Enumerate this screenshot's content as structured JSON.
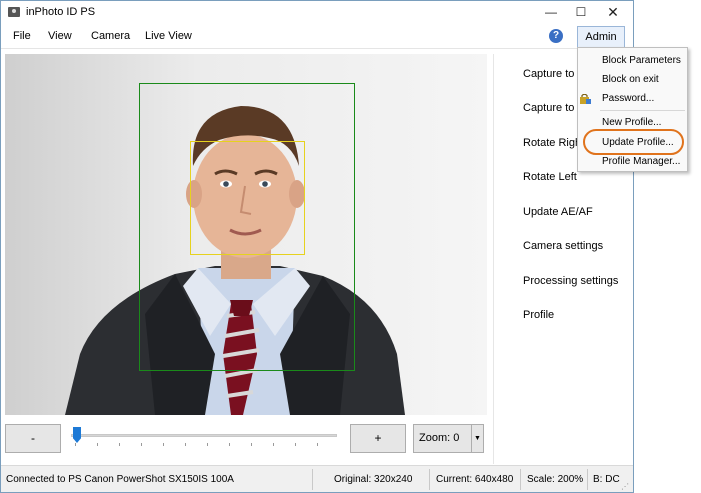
{
  "window": {
    "title": "inPhoto ID PS",
    "controls": {
      "minimize": "—",
      "maximize": "☐",
      "close": "✕"
    }
  },
  "menu": {
    "items": [
      "File",
      "View",
      "Camera",
      "Live View"
    ],
    "help_glyph": "?",
    "admin_label": "Admin"
  },
  "admin_menu": {
    "items": [
      "Block Parameters",
      "Block on exit",
      "Password...",
      "New Profile...",
      "Update Profile...",
      "Profile Manager..."
    ],
    "highlighted": "Update Profile..."
  },
  "side_panel": {
    "items": [
      "Capture to T",
      "Capture to F",
      "Rotate Right",
      "Rotate Left",
      "Update AE/AF",
      "Camera settings",
      "Processing settings",
      "Profile"
    ]
  },
  "controls": {
    "minus_label": "-",
    "plus_label": "+",
    "zoom_label": "Zoom: 0",
    "zoom_arrow": "▼",
    "zoom_slider_level": 0
  },
  "status": {
    "connection": "Connected to PS Canon PowerShot SX150IS 100A",
    "original": "Original: 320x240",
    "current": "Current: 640x480",
    "scale": "Scale: 200%",
    "b": "B: DC"
  },
  "colors": {
    "face_frame": "#1a8a1a",
    "head_frame": "#e6d21e",
    "highlight_ring": "#e0731c",
    "slider_thumb": "#1e7ad6"
  }
}
